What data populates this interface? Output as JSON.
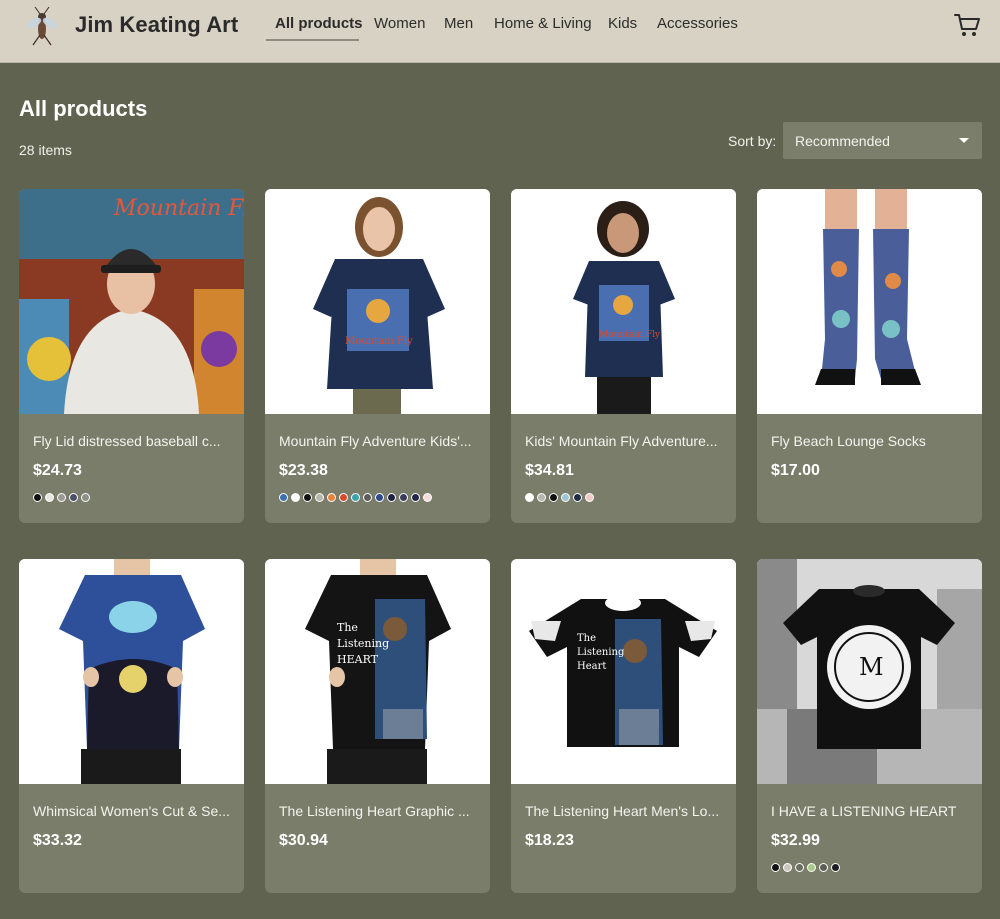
{
  "header": {
    "brand": "Jim Keating Art",
    "logo_icon": "insect-logo-icon",
    "nav": [
      {
        "label": "All products",
        "active": true
      },
      {
        "label": "Women",
        "active": false
      },
      {
        "label": "Men",
        "active": false
      },
      {
        "label": "Home & Living",
        "active": false
      },
      {
        "label": "Kids",
        "active": false
      },
      {
        "label": "Accessories",
        "active": false
      }
    ],
    "cart_icon": "cart-icon"
  },
  "listing": {
    "title": "All products",
    "count": "28 items",
    "sort_label": "Sort by:",
    "sort_value": "Recommended"
  },
  "products": [
    {
      "title": "Fly Lid distressed baseball c...",
      "price": "$24.73",
      "image": "woman-wearing-baseball-cap-photo",
      "swatches": [
        "#111111",
        "#e8e8e2",
        "#9a9a92",
        "#4b4f6a",
        "#8c8f86"
      ]
    },
    {
      "title": "Mountain Fly Adventure Kids'...",
      "price": "$23.38",
      "image": "girl-in-navy-tshirt-photo",
      "swatches": [
        "#3b6fb0",
        "#ffffff",
        "#111111",
        "#b9b6ad",
        "#e6833a",
        "#d94a2b",
        "#3aa3ad",
        "#5a5d5a",
        "#2e4a8a",
        "#1f2240",
        "#3a3b5a",
        "#22264a",
        "#f4dcdc"
      ]
    },
    {
      "title": "Kids' Mountain Fly Adventure...",
      "price": "$34.81",
      "image": "child-in-navy-tshirt-photo",
      "swatches": [
        "#ffffff",
        "#b9b6ad",
        "#111111",
        "#9cc4d6",
        "#1f2b48",
        "#f2c9c9"
      ]
    },
    {
      "title": "Fly Beach Lounge Socks",
      "price": "$17.00",
      "image": "printed-socks-photo",
      "swatches": []
    },
    {
      "title": "Whimsical Women's Cut & Se...",
      "price": "$33.32",
      "image": "womens-all-over-print-tshirt-photo",
      "swatches": []
    },
    {
      "title": "The Listening Heart Graphic ...",
      "price": "$30.94",
      "image": "womens-black-graphic-tshirt-photo",
      "swatches": []
    },
    {
      "title": "The Listening Heart Men's Lo...",
      "price": "$18.23",
      "image": "mens-black-graphic-tshirt-photo",
      "swatches": []
    },
    {
      "title": "I HAVE a LISTENING HEART",
      "price": "$32.99",
      "image": "black-tshirt-city-background-photo",
      "swatches": [
        "#111111",
        "#c9c7be",
        "#6b6e5f",
        "#a9c98a",
        "#5b5e52",
        "#1c1c22"
      ]
    }
  ]
}
